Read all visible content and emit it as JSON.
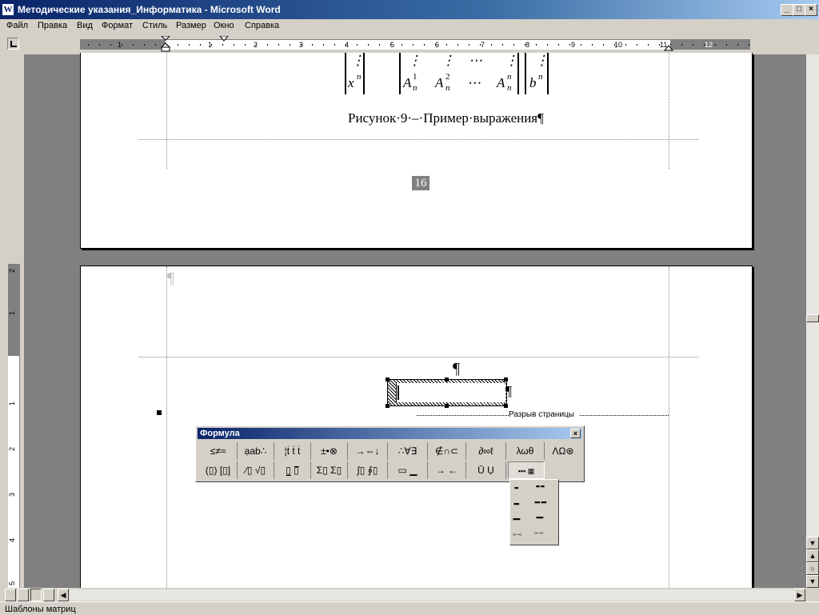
{
  "window": {
    "title": "Методические указания_Информатика - Microsoft Word",
    "min": "_",
    "max": "□",
    "close": "×"
  },
  "menu": [
    "Файл",
    "Правка",
    "Вид",
    "Формат",
    "Стиль",
    "Размер",
    "Окно",
    "Справка"
  ],
  "ruler": {
    "left_num": "1",
    "numbers": [
      "1",
      "2",
      "3",
      "4",
      "5",
      "6",
      "7",
      "8",
      "9",
      "10",
      "11",
      "12"
    ],
    "vnumbers": [
      "2",
      "1",
      "1",
      "2",
      "3",
      "4",
      "5"
    ]
  },
  "page1": {
    "matrix_col1": [
      "⋮",
      "x"
    ],
    "matrix_col1_sup": "n",
    "matrix_row_vdots": [
      "⋮",
      "⋮",
      "⋯",
      "⋮",
      "⋮"
    ],
    "matrix_row": [
      "A",
      "A",
      "⋯",
      "A"
    ],
    "matrix_sub": "n",
    "matrix_sups": [
      "1",
      "2",
      "n"
    ],
    "rhs": "b",
    "rhs_sup": "n",
    "caption": "Рисунок·9·–·Пример·выражения¶",
    "page_number": "16"
  },
  "page2": {
    "pilcrow_top": "¶",
    "pilcrow_mid": "¶",
    "pilcrow_box": "¶",
    "page_break_label": "Разрыв страницы"
  },
  "formula_toolbar": {
    "title": "Формула",
    "close": "×",
    "row1": [
      "≤≠≈",
      "ạab∴",
      "¦ṫ ṫ ṫ",
      "±•⊗",
      "→⇔↓",
      "∴∀∃",
      "∉∩⊂",
      "∂∞ℓ",
      "λωθ",
      "ΛΩ⊛"
    ],
    "row2": [
      "(▯) [▯]",
      "⁄▯ √▯",
      "▯̲ ▯̅",
      "Σ▯ Σ▯",
      "∫▯ ∮▯",
      "▭ ▁",
      "→ ←",
      "Ū Ụ",
      "▪▪▪ ▦"
    ]
  },
  "matrix_menu": [
    [
      "▪▪",
      "▪▪ ▪▪"
    ],
    [
      "▪▪▪",
      "▪▪▪ ▪▪▪"
    ],
    [
      "▪▪▪▪",
      "▪▪▪▪"
    ],
    [
      "▫···▫",
      "▫···▫"
    ]
  ],
  "scroll": {
    "up": "▲",
    "down": "▼",
    "left": "◀",
    "right": "▶",
    "prev": "▲",
    "select": "○",
    "next": "▼"
  },
  "status": {
    "text": "Шаблоны матриц"
  },
  "colors": {
    "titlebar": "#0a246a",
    "chrome": "#d4d0c8",
    "workspace": "#808080"
  }
}
